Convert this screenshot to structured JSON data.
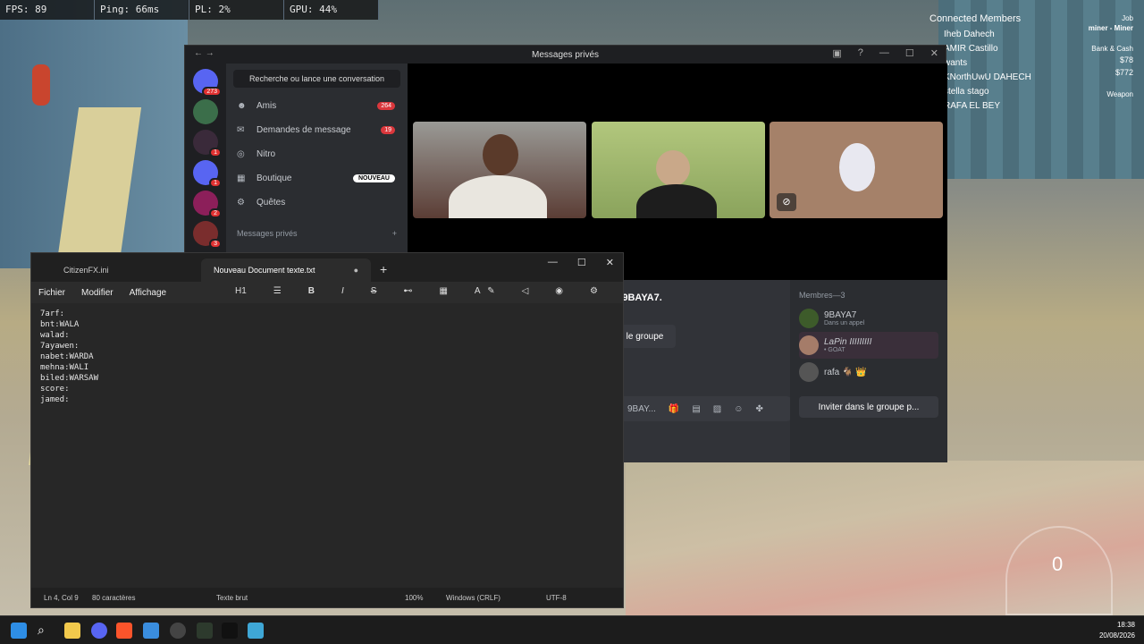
{
  "perf": {
    "fps": "FPS: 89",
    "ping": "Ping: 66ms",
    "pl": "PL: 2%",
    "gpu": "GPU: 44%"
  },
  "connected": {
    "title": "Connected Members",
    "members": [
      "Iheb Dahech",
      "AMIR Castillo",
      "wants",
      "KNorthUwU DAHECH",
      "stella stago",
      "RAFA EL BEY"
    ]
  },
  "hud": {
    "job_label": "Job",
    "job": "miner - Miner",
    "bank_label": "Bank & Cash",
    "bank": "$78",
    "cash": "$772",
    "weapon": "Weapon"
  },
  "speedo": {
    "value": "0"
  },
  "discord": {
    "window_title": "Messages privés",
    "search_placeholder": "Recherche ou lance une conversation",
    "server_badges": [
      "273",
      "",
      "1",
      "1",
      "2",
      "3"
    ],
    "nav": [
      {
        "label": "Amis",
        "count": "264",
        "icon": "friends-icon"
      },
      {
        "label": "Demandes de message",
        "count": "19",
        "icon": "mail-icon"
      },
      {
        "label": "Nitro",
        "count": "",
        "icon": "nitro-icon"
      },
      {
        "label": "Boutique",
        "badge": "NOUVEAU",
        "icon": "shop-icon"
      },
      {
        "label": "Quêtes",
        "count": "",
        "icon": "quests-icon"
      }
    ],
    "dm_section": "Messages privés",
    "group_name_partial": "IIII, 9BAYA7.",
    "group_button": "le groupe",
    "chat_placeholder": "9BAY...",
    "members_header": "Membres—3",
    "members": [
      {
        "name": "9BAYA7",
        "status": "Dans un appel"
      },
      {
        "name": "LaPin IIIIIIIII",
        "status": "• GOAT"
      },
      {
        "name": "rafa 🐐 👑",
        "status": ""
      }
    ],
    "invite_label": "Inviter dans le groupe p..."
  },
  "notepad": {
    "tabs": [
      "CitizenFX.ini",
      "Nouveau Document texte.txt"
    ],
    "menu": [
      "Fichier",
      "Modifier",
      "Affichage"
    ],
    "heading": "H1",
    "lines": [
      "7arf:",
      "bnt:WALA",
      "walad:",
      "7ayawen:",
      "nabet:WARDA",
      "mehna:WALI",
      "biled:WARSAW",
      "score:",
      "jamed:"
    ],
    "status": {
      "pos": "Ln 4, Col 9",
      "chars": "80 caractères",
      "format": "Texte brut",
      "zoom": "100%",
      "eol": "Windows (CRLF)",
      "enc": "UTF-8"
    }
  },
  "tray": {
    "time": "18:38",
    "date": "20/08/2026"
  },
  "colors": {
    "discord_bg": "#1e1f22",
    "discord_sidebar": "#2b2d31",
    "badge_red": "#da373c",
    "notepad_bg": "#272727"
  }
}
